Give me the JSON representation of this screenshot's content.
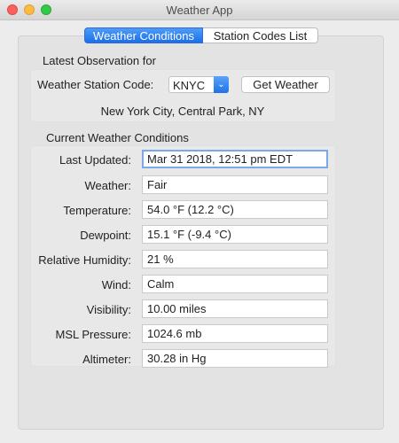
{
  "window": {
    "title": "Weather App"
  },
  "tabs": [
    {
      "label": "Weather Conditions",
      "active": true
    },
    {
      "label": "Station Codes List",
      "active": false
    }
  ],
  "latest": {
    "heading": "Latest Observation for",
    "station_label": "Weather Station Code:",
    "station_value": "KNYC",
    "get_button": "Get Weather",
    "location": "New York City, Central Park, NY"
  },
  "current": {
    "heading": "Current Weather Conditions",
    "rows": [
      {
        "label": "Last Updated:",
        "value": "Mar 31 2018, 12:51 pm EDT"
      },
      {
        "label": "Weather:",
        "value": "Fair"
      },
      {
        "label": "Temperature:",
        "value": "54.0 °F  (12.2 °C)"
      },
      {
        "label": "Dewpoint:",
        "value": "15.1 °F  (-9.4 °C)"
      },
      {
        "label": "Relative Humidity:",
        "value": "21 %"
      },
      {
        "label": "Wind:",
        "value": "Calm"
      },
      {
        "label": "Visibility:",
        "value": "10.00 miles"
      },
      {
        "label": "MSL Pressure:",
        "value": "1024.6 mb"
      },
      {
        "label": "Altimeter:",
        "value": "30.28 in Hg"
      }
    ]
  }
}
